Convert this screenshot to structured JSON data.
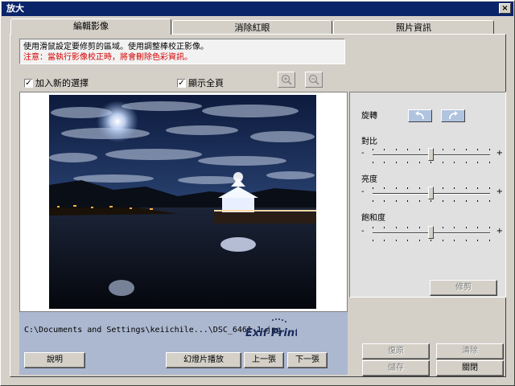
{
  "window": {
    "title": "放大",
    "close_label": "×"
  },
  "tabs": [
    {
      "label": "編輯影像",
      "active": true
    },
    {
      "label": "消除紅眼",
      "active": false
    },
    {
      "label": "照片資訊",
      "active": false
    }
  ],
  "info": {
    "line1": "使用滑鼠設定要修剪的區域。使用調整棒校正影像。",
    "line2": "注意：當執行影像校正時，將會刪除色彩資訊。"
  },
  "checkboxes": {
    "add_selection": {
      "label": "加入新的選擇",
      "checked": true,
      "mark": "✓"
    },
    "show_full": {
      "label": "顯示全頁",
      "checked": true,
      "mark": "✓"
    }
  },
  "path": {
    "text": "C:\\Documents and Settings\\keiichile...\\DSC_6461-1.jpg"
  },
  "logo": {
    "text": "Exif Print"
  },
  "buttons": {
    "help": "說明",
    "slideshow": "幻燈片播放",
    "prev": "上一張",
    "next": "下一張",
    "trim": "修剪",
    "restore": "復原",
    "clear": "清除",
    "save": "儲存",
    "close": "關閉"
  },
  "adjust": {
    "rotate_label": "旋轉",
    "contrast_label": "對比",
    "brightness_label": "亮度",
    "saturation_label": "飽和度",
    "minus": "-",
    "plus": "+"
  },
  "colors": {
    "titlebar": "#0a246a",
    "warning": "#d40000",
    "path_bar": "#acb8d0"
  }
}
